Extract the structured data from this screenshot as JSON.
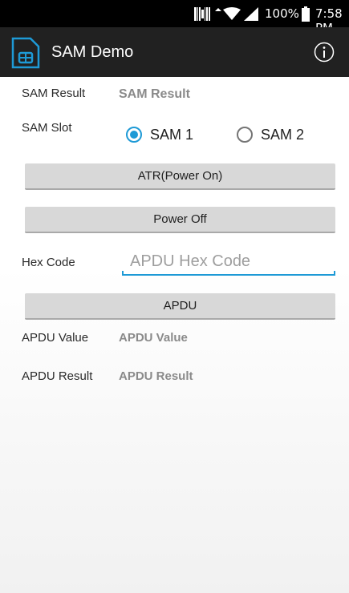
{
  "status_bar": {
    "battery": "100%",
    "time": "7:58 PM"
  },
  "app_bar": {
    "title": "SAM Demo"
  },
  "sam_result": {
    "label": "SAM Result",
    "value": "SAM Result"
  },
  "sam_slot": {
    "label": "SAM Slot",
    "options": [
      {
        "label": "SAM 1",
        "checked": true
      },
      {
        "label": "SAM 2",
        "checked": false
      }
    ]
  },
  "buttons": {
    "atr": "ATR(Power On)",
    "power_off": "Power Off",
    "apdu": "APDU"
  },
  "hex_code": {
    "label": "Hex Code",
    "value": "",
    "placeholder": "APDU Hex Code"
  },
  "apdu_value": {
    "label": "APDU Value",
    "value": "APDU Value"
  },
  "apdu_result": {
    "label": "APDU Result",
    "value": "APDU Result"
  },
  "colors": {
    "accent": "#1e9ad6",
    "app_bar": "#212121",
    "status_bar": "#000000",
    "button": "#d8d8d8"
  },
  "icons": {
    "app": "sim-card-icon",
    "info": "info-icon",
    "signal": "signal-icon",
    "wifi": "wifi-icon",
    "battery": "battery-icon",
    "barcode": "barcode-icon"
  }
}
